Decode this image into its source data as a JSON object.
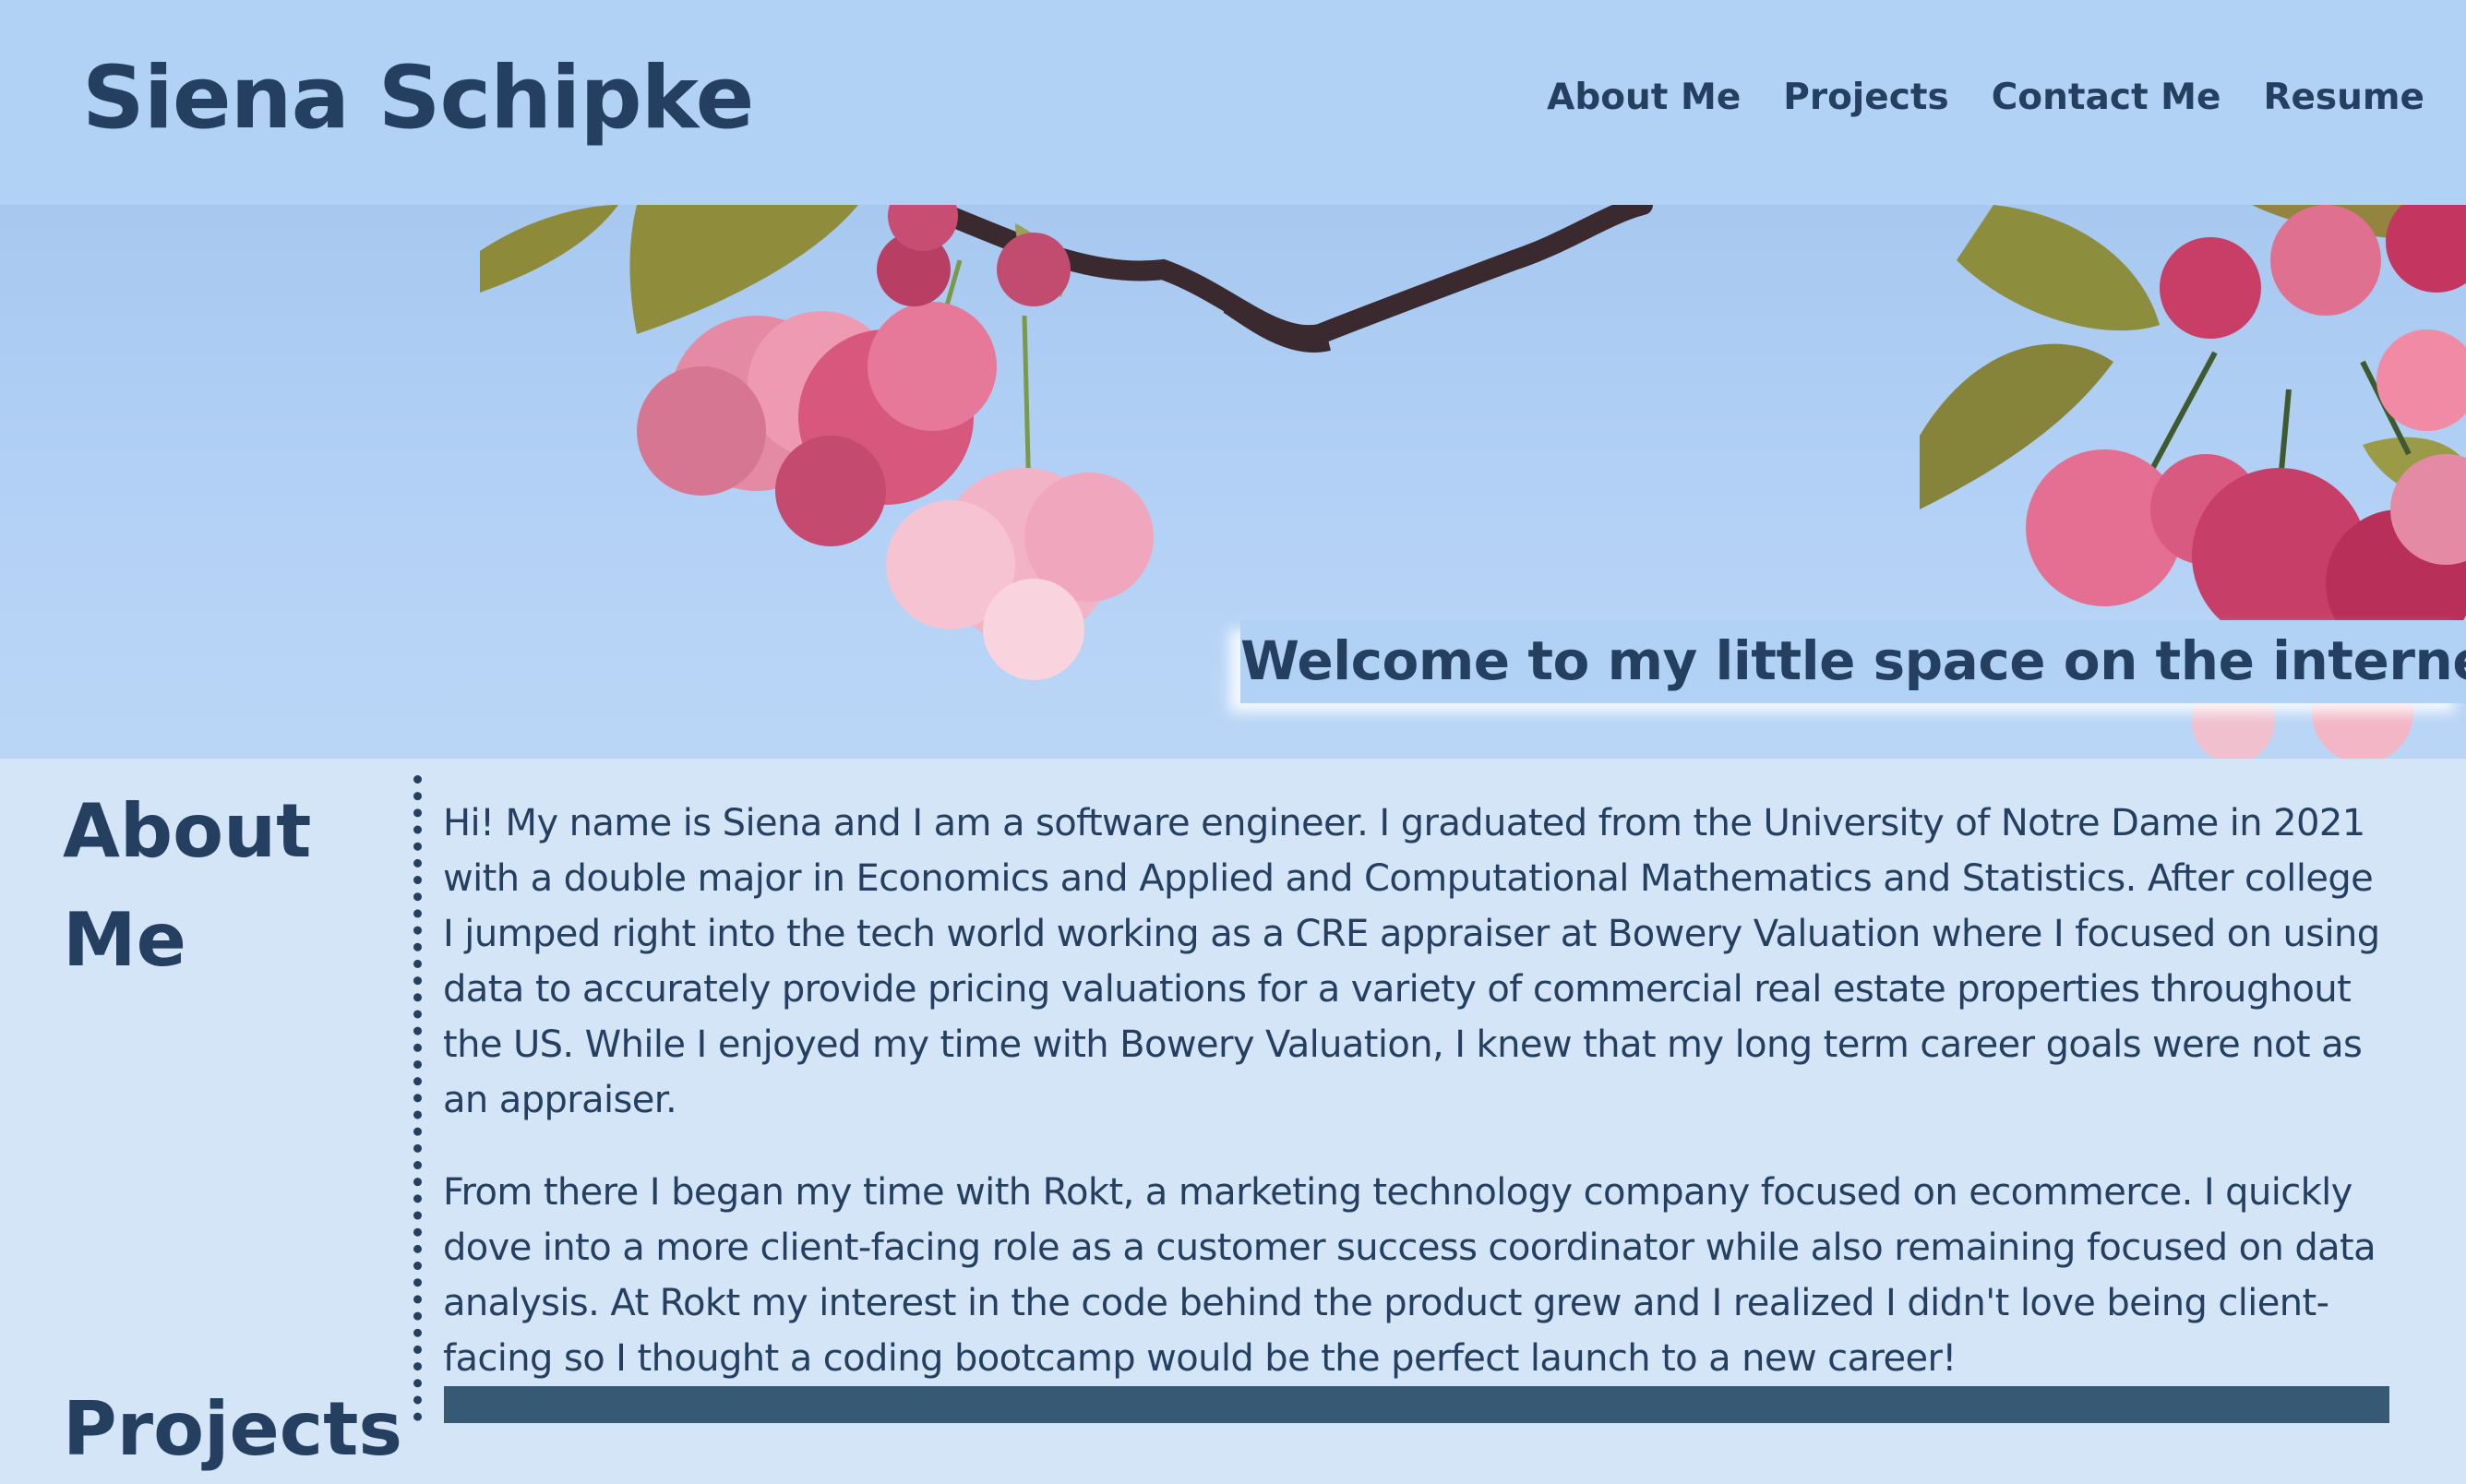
{
  "header": {
    "title": "Siena Schipke",
    "nav": [
      {
        "label": "About Me"
      },
      {
        "label": "Projects"
      },
      {
        "label": "Contact Me"
      },
      {
        "label": "Resume"
      }
    ]
  },
  "hero": {
    "welcome": "Welcome to my little space on the internet!",
    "image_subject": "pink cherry blossoms against a blue sky"
  },
  "about": {
    "heading": "About Me",
    "paragraphs": [
      "Hi! My name is Siena and I am a software engineer. I graduated from the University of Notre Dame in 2021 with a double major in Economics and Applied and Computational Mathematics and Statistics. After college I jumped right into the tech world working as a CRE appraiser at Bowery Valuation where I focused on using data to accurately provide pricing valuations for a variety of commercial real estate properties throughout the US. While I enjoyed my time with Bowery Valuation, I knew that my long term career goals were not as an appraiser.",
      "From there I began my time with Rokt, a marketing technology company focused on ecommerce. I quickly dove into a more client-facing role as a customer success coordinator while also remaining focused on data analysis. At Rokt my interest in the code behind the product grew and I realized I didn't love being client-facing so I thought a coding bootcamp would be the perfect launch to a new career!"
    ]
  },
  "projects": {
    "heading": "Projects"
  },
  "colors": {
    "header_bg": "#b1d2f5",
    "page_bg": "#d3e5f7",
    "text": "#243f5f",
    "projects_bar": "#375a74"
  }
}
